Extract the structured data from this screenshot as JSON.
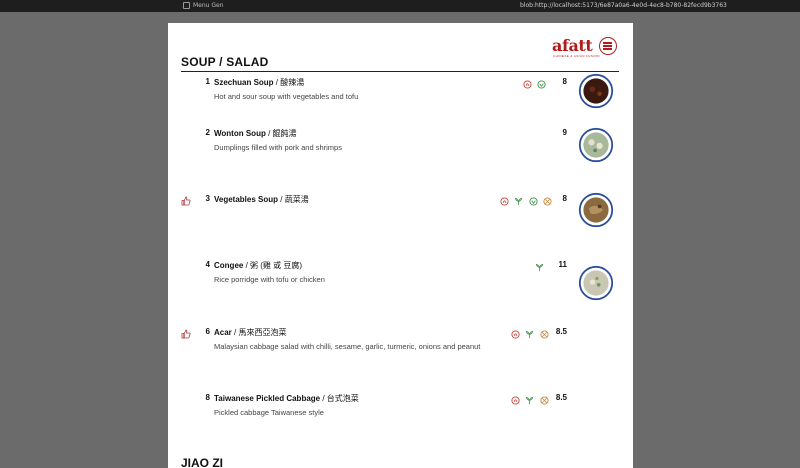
{
  "browser": {
    "tab_title": "Menu Gen",
    "url": "blob:http://localhost:5173/6e87a0a6-4e0d-4ec8-b780-82fecd9b3763"
  },
  "brand": {
    "logo_text": "afatt",
    "tagline": "CHINESE & ASIAN FUSION",
    "accent_color": "#b31b1b"
  },
  "section": {
    "title": "SOUP / SALAD"
  },
  "next_section": {
    "title": "JIAO ZI"
  },
  "items": [
    {
      "number": "1",
      "name": "Szechuan Soup",
      "chinese": "酸辣湯",
      "description": "Hot and sour soup with vegetables and tofu",
      "price": "8",
      "recommended": false,
      "icons": [
        "spicy-icon",
        "vegan-icon"
      ],
      "photo_label": "Szechuan Soup"
    },
    {
      "number": "2",
      "name": "Wonton Soup",
      "chinese": "餛飩湯",
      "description": "Dumplings filled with pork and shrimps",
      "price": "9",
      "recommended": false,
      "icons": [],
      "photo_label": "Wonton Soup"
    },
    {
      "number": "3",
      "name": "Vegetables Soup",
      "chinese": "蔬菜湯",
      "description": "",
      "price": "8",
      "recommended": true,
      "icons": [
        "spicy-icon",
        "vegetarian-icon",
        "vegan-icon",
        "gluten-free-icon"
      ],
      "photo_label": "Vegetables Soup"
    },
    {
      "number": "4",
      "name": "Congee",
      "chinese": "粥 (雞 或 豆腐)",
      "description": "Rice porridge with tofu or chicken",
      "price": "11",
      "recommended": false,
      "icons": [
        "vegetarian-icon"
      ],
      "photo_label": "Congee"
    },
    {
      "number": "6",
      "name": "Acar",
      "chinese": "馬來西亞泡菜",
      "description": "Malaysian cabbage salad with chilli, sesame, garlic, turmeric, onions and peanut",
      "price": "8.5",
      "recommended": true,
      "icons": [
        "spicy-icon",
        "vegetarian-icon",
        "gluten-free-icon"
      ],
      "photo_label": ""
    },
    {
      "number": "8",
      "name": "Taiwanese Pickled Cabbage",
      "chinese": "台式泡菜",
      "description": "Pickled cabbage Taiwanese style",
      "price": "8.5",
      "recommended": false,
      "icons": [
        "spicy-icon",
        "vegetarian-icon",
        "gluten-free-icon"
      ],
      "photo_label": ""
    }
  ],
  "photos": [
    {
      "label": "Szechuan Soup",
      "fill": "#3a1a10",
      "rim": "#2a4f9a"
    },
    {
      "label": "Wonton Soup",
      "fill": "#a8b89a",
      "rim": "#2a4f9a"
    },
    {
      "label": "Vegetables Soup",
      "fill": "#8a6a3e",
      "rim": "#2a4f9a"
    },
    {
      "label": "Congee",
      "fill": "#c9c6b4",
      "rim": "#2a4f9a"
    }
  ]
}
